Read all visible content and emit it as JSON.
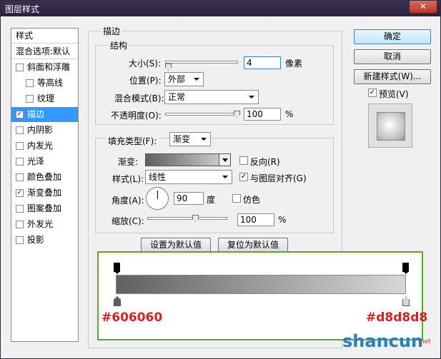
{
  "window": {
    "title": "图层样式",
    "close": "✕"
  },
  "sidebar": {
    "header": "样式",
    "blend_options": "混合选项:默认",
    "items": [
      {
        "label": "斜面和浮雕",
        "checked": false
      },
      {
        "label": "等高线",
        "checked": false
      },
      {
        "label": "纹理",
        "checked": false
      },
      {
        "label": "描边",
        "checked": true
      },
      {
        "label": "内阴影",
        "checked": false
      },
      {
        "label": "内发光",
        "checked": false
      },
      {
        "label": "光泽",
        "checked": false
      },
      {
        "label": "颜色叠加",
        "checked": false
      },
      {
        "label": "渐变叠加",
        "checked": true
      },
      {
        "label": "图案叠加",
        "checked": false
      },
      {
        "label": "外发光",
        "checked": false
      },
      {
        "label": "投影",
        "checked": false
      }
    ]
  },
  "stroke": {
    "section_title": "描边",
    "structure_title": "结构",
    "size_label": "大小(S):",
    "size_value": "4",
    "size_unit": "像素",
    "position_label": "位置(P):",
    "position_value": "外部",
    "blend_label": "混合模式(B):",
    "blend_value": "正常",
    "opacity_label": "不透明度(O):",
    "opacity_value": "100",
    "opacity_unit": "%",
    "fill_type_label": "填充类型(F):",
    "fill_type_value": "渐变",
    "gradient_label": "渐变:",
    "reverse_label": "反向(R)",
    "reverse_checked": false,
    "style_label": "样式(L):",
    "style_value": "线性",
    "align_label": "与图层对齐(G)",
    "align_checked": true,
    "angle_label": "角度(A):",
    "angle_value": "90",
    "angle_unit": "度",
    "dither_label": "仿色",
    "dither_checked": false,
    "scale_label": "缩放(C):",
    "scale_value": "100",
    "scale_unit": "%",
    "set_default": "设置为默认值",
    "reset_default": "复位为默认值"
  },
  "buttons": {
    "ok": "确定",
    "cancel": "取消",
    "new_style": "新建样式(W)...",
    "preview_label": "预览(V)",
    "preview_checked": true
  },
  "gradient_editor": {
    "start_color": "#606060",
    "end_color": "#d8d8d8"
  },
  "watermark": {
    "text_main": "shancun",
    "text_net": ".net"
  }
}
